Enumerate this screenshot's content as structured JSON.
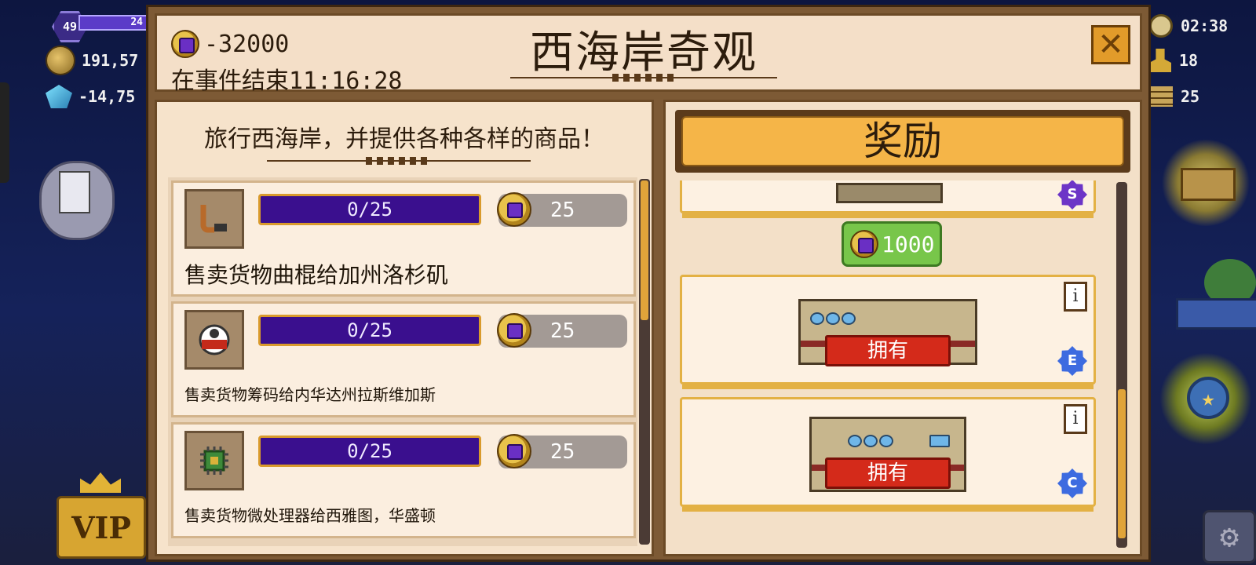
{
  "hud": {
    "level": "49",
    "xp": "24",
    "coins": "191,57",
    "gems": "-14,75",
    "vip_label": "VIP",
    "clock": "02:38",
    "workers": "18",
    "items": "25"
  },
  "dialog": {
    "title": "西海岸奇观",
    "cost": "-32000",
    "ends_prefix": "在事件结束",
    "ends_time": "11:16:28",
    "close_icon": "✕"
  },
  "left_panel": {
    "tagline": "旅行西海岸，并提供各种各样的商品！",
    "tasks": [
      {
        "icon": "crank-icon",
        "progress": "0/25",
        "reward": "25",
        "description": "售卖货物曲棍给加州洛杉矶"
      },
      {
        "icon": "poker-chips-icon",
        "progress": "0/25",
        "reward": "25",
        "description": "售卖货物筹码给内华达州拉斯维加斯"
      },
      {
        "icon": "microprocessor-icon",
        "progress": "0/25",
        "reward": "25",
        "description": "售卖货物微处理器给西雅图，华盛顿"
      }
    ]
  },
  "right_panel": {
    "header": "奖励",
    "gem_reward": "1000",
    "cards": [
      {
        "rank": "S",
        "info": "i"
      },
      {
        "rank": "E",
        "info": "i",
        "owned": "拥有"
      },
      {
        "rank": "C",
        "info": "i",
        "owned": "拥有"
      }
    ]
  },
  "colors": {
    "panel_bg": "#f6e3cb",
    "frame": "#7d5a35",
    "progress_fill": "#3a0f8e",
    "accent_orange": "#f5b548",
    "owned_red": "#d42a1a",
    "gem_green": "#78c64a"
  }
}
